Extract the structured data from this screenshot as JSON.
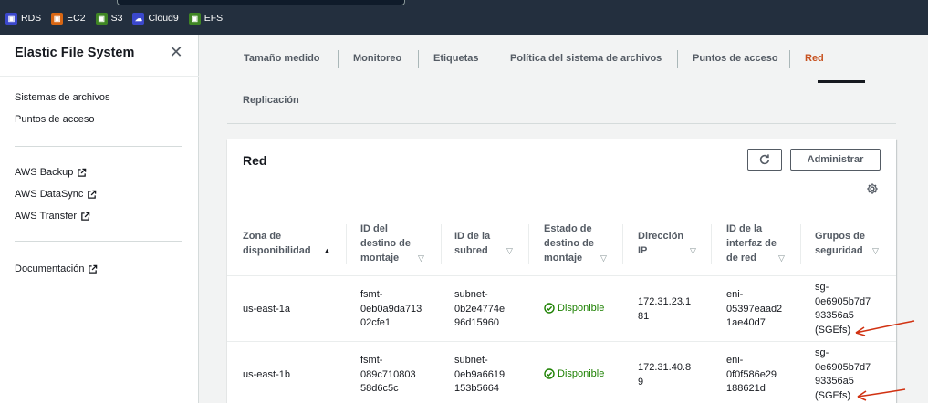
{
  "favorites": [
    {
      "label": "RDS",
      "icon": "rds-icon",
      "color": "#3b48cc"
    },
    {
      "label": "EC2",
      "icon": "ec2-icon",
      "color": "#d86613"
    },
    {
      "label": "S3",
      "icon": "s3-icon",
      "color": "#3f8624"
    },
    {
      "label": "Cloud9",
      "icon": "cloud9-icon",
      "color": "#3b48cc"
    },
    {
      "label": "EFS",
      "icon": "efs-icon",
      "color": "#3f8624"
    }
  ],
  "sidebar": {
    "title": "Elastic File System",
    "nav": [
      "Sistemas de archivos",
      "Puntos de acceso"
    ],
    "external": [
      "AWS Backup",
      "AWS DataSync",
      "AWS Transfer"
    ],
    "docs": "Documentación"
  },
  "tabs": [
    {
      "label": "Tamaño medido",
      "active": false
    },
    {
      "label": "Monitoreo",
      "active": false
    },
    {
      "label": "Etiquetas",
      "active": false
    },
    {
      "label": "Política del sistema de archivos",
      "active": false
    },
    {
      "label": "Puntos de acceso",
      "active": false
    },
    {
      "label": "Red",
      "active": true
    },
    {
      "label": "Replicación",
      "active": false
    }
  ],
  "panel": {
    "title": "Red",
    "manage_label": "Administrar",
    "columns": [
      [
        "Zona de",
        "disponibilidad"
      ],
      [
        "ID del",
        "destino de",
        "montaje"
      ],
      [
        "ID de la",
        "subred"
      ],
      [
        "Estado de",
        "destino de",
        "montaje"
      ],
      [
        "Dirección",
        "IP"
      ],
      [
        "ID de la",
        "interfaz de",
        "de red"
      ],
      [
        "Grupos de",
        "seguridad"
      ]
    ],
    "rows": [
      {
        "zone": "us-east-1a",
        "mount": [
          "fsmt-",
          "0eb0a9da713",
          "02cfe1"
        ],
        "subnet": [
          "subnet-",
          "0b2e4774e",
          "96d15960"
        ],
        "status": "Disponible",
        "ip": [
          "172.31.23.1",
          "81"
        ],
        "eni": [
          "eni-",
          "05397eaad2",
          "1ae40d7"
        ],
        "sg": [
          "sg-",
          "0e6905b7d7",
          "93356a5",
          "(SGEfs)"
        ]
      },
      {
        "zone": "us-east-1b",
        "mount": [
          "fsmt-",
          "089c710803",
          "58d6c5c"
        ],
        "subnet": [
          "subnet-",
          "0eb9a6619",
          "153b5664"
        ],
        "status": "Disponible",
        "ip": [
          "172.31.40.8",
          "9"
        ],
        "eni": [
          "eni-",
          "0f0f586e29",
          "188621d"
        ],
        "sg": [
          "sg-",
          "0e6905b7d7",
          "93356a5",
          "(SGEfs)"
        ]
      }
    ]
  },
  "colors": {
    "topbar": "#232f3e",
    "active_tab": "#c7511f",
    "status_ok": "#1d8102",
    "annotation_arrow": "#d13212"
  }
}
